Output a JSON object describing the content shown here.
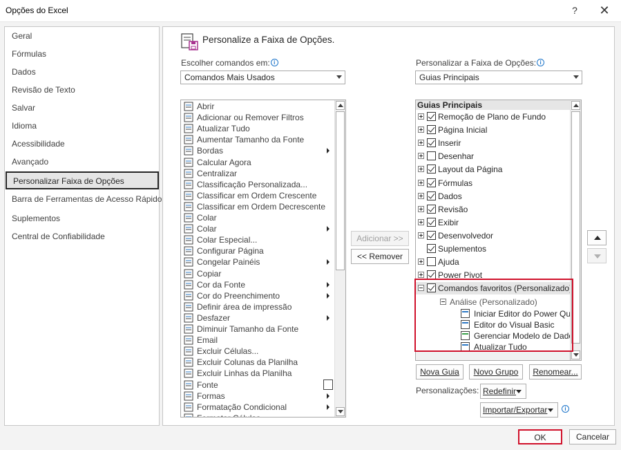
{
  "window": {
    "title": "Opções do Excel",
    "help": "?",
    "close": "✕"
  },
  "nav": {
    "items": [
      {
        "label": "Geral"
      },
      {
        "label": "Fórmulas"
      },
      {
        "label": "Dados"
      },
      {
        "label": "Revisão de Texto"
      },
      {
        "label": "Salvar"
      },
      {
        "label": "Idioma"
      },
      {
        "label": "Acessibilidade"
      },
      {
        "label": "Avançado"
      },
      {
        "label": "Personalizar Faixa de Opções",
        "selected": true
      },
      {
        "label": "Barra de Ferramentas de Acesso Rápido"
      },
      {
        "label": "Suplementos"
      },
      {
        "label": "Central de Confiabilidade"
      }
    ]
  },
  "header": {
    "title": "Personalize a Faixa de Opções."
  },
  "left_panel": {
    "label": "Escolher comandos em:",
    "selected": "Comandos Mais Usados",
    "commands": [
      "Abrir",
      "Adicionar ou Remover Filtros",
      "Atualizar Tudo",
      "Aumentar Tamanho da Fonte",
      "Bordas",
      "Calcular Agora",
      "Centralizar",
      "Classificação Personalizada...",
      "Classificar em Ordem Crescente",
      "Classificar em Ordem Decrescente",
      "Colar",
      "Colar",
      "Colar Especial...",
      "Configurar Página",
      "Congelar Painéis",
      "Copiar",
      "Cor da Fonte",
      "Cor do Preenchimento",
      "Definir área de impressão",
      "Desfazer",
      "Diminuir Tamanho da Fonte",
      "Email",
      "Excluir Células...",
      "Excluir Colunas da Planilha",
      "Excluir Linhas da Planilha",
      "Fonte",
      "Formas",
      "Formatação Condicional",
      "Formatar Células..."
    ]
  },
  "middle": {
    "add": "Adicionar >>",
    "remove": "<< Remover"
  },
  "right_panel": {
    "label": "Personalizar a Faixa de Opções:",
    "selected": "Guias Principais",
    "tree_header": "Guias Principais",
    "tabs": [
      {
        "label": "Remoção de Plano de Fundo",
        "checked": true
      },
      {
        "label": "Página Inicial",
        "checked": true
      },
      {
        "label": "Inserir",
        "checked": true
      },
      {
        "label": "Desenhar",
        "checked": false
      },
      {
        "label": "Layout da Página",
        "checked": true
      },
      {
        "label": "Fórmulas",
        "checked": true
      },
      {
        "label": "Dados",
        "checked": true
      },
      {
        "label": "Revisão",
        "checked": true
      },
      {
        "label": "Exibir",
        "checked": true
      },
      {
        "label": "Desenvolvedor",
        "checked": true
      },
      {
        "label": "Suplementos",
        "checked": true
      },
      {
        "label": "Ajuda",
        "checked": false
      },
      {
        "label": "Power Pivot",
        "checked": true
      }
    ],
    "custom_tab": "Comandos favoritos (Personalizado)",
    "custom_group": "Análise (Personalizado)",
    "custom_commands": [
      "Iniciar Editor do Power Query...",
      "Editor do Visual Basic",
      "Gerenciar Modelo de Dados",
      "Atualizar Tudo"
    ],
    "new_tab": "Nova Guia",
    "new_group": "Novo Grupo",
    "rename": "Renomear...",
    "customizations_label": "Personalizações:",
    "reset": "Redefinir",
    "import_export": "Importar/Exportar"
  },
  "footer": {
    "ok": "OK",
    "cancel": "Cancelar"
  },
  "colors": {
    "highlight": "#d0102a",
    "accent": "#1a73c9"
  }
}
